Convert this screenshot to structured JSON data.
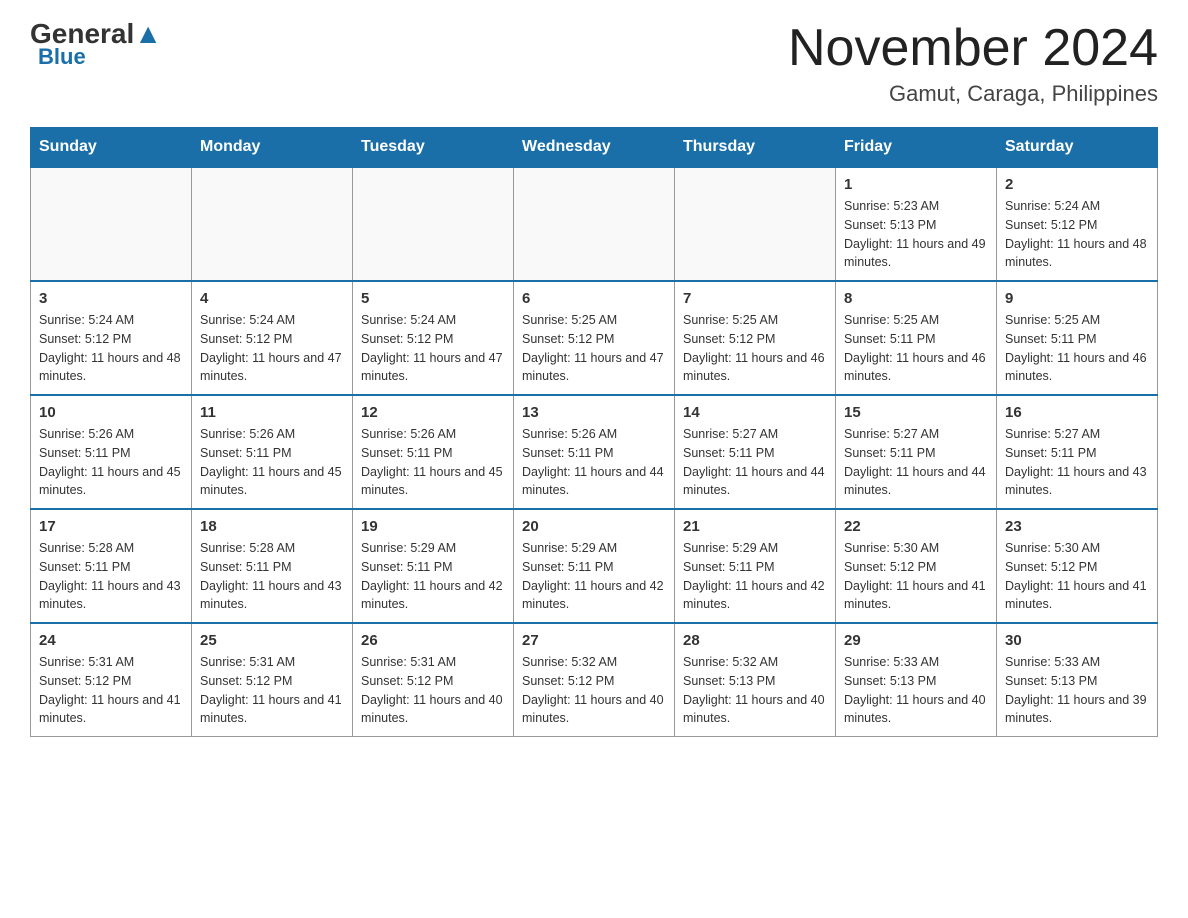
{
  "logo": {
    "general": "General",
    "blue": "Blue"
  },
  "title": "November 2024",
  "subtitle": "Gamut, Caraga, Philippines",
  "days_of_week": [
    "Sunday",
    "Monday",
    "Tuesday",
    "Wednesday",
    "Thursday",
    "Friday",
    "Saturday"
  ],
  "weeks": [
    [
      {
        "day": null,
        "sunrise": null,
        "sunset": null,
        "daylight": null
      },
      {
        "day": null,
        "sunrise": null,
        "sunset": null,
        "daylight": null
      },
      {
        "day": null,
        "sunrise": null,
        "sunset": null,
        "daylight": null
      },
      {
        "day": null,
        "sunrise": null,
        "sunset": null,
        "daylight": null
      },
      {
        "day": null,
        "sunrise": null,
        "sunset": null,
        "daylight": null
      },
      {
        "day": "1",
        "sunrise": "Sunrise: 5:23 AM",
        "sunset": "Sunset: 5:13 PM",
        "daylight": "Daylight: 11 hours and 49 minutes."
      },
      {
        "day": "2",
        "sunrise": "Sunrise: 5:24 AM",
        "sunset": "Sunset: 5:12 PM",
        "daylight": "Daylight: 11 hours and 48 minutes."
      }
    ],
    [
      {
        "day": "3",
        "sunrise": "Sunrise: 5:24 AM",
        "sunset": "Sunset: 5:12 PM",
        "daylight": "Daylight: 11 hours and 48 minutes."
      },
      {
        "day": "4",
        "sunrise": "Sunrise: 5:24 AM",
        "sunset": "Sunset: 5:12 PM",
        "daylight": "Daylight: 11 hours and 47 minutes."
      },
      {
        "day": "5",
        "sunrise": "Sunrise: 5:24 AM",
        "sunset": "Sunset: 5:12 PM",
        "daylight": "Daylight: 11 hours and 47 minutes."
      },
      {
        "day": "6",
        "sunrise": "Sunrise: 5:25 AM",
        "sunset": "Sunset: 5:12 PM",
        "daylight": "Daylight: 11 hours and 47 minutes."
      },
      {
        "day": "7",
        "sunrise": "Sunrise: 5:25 AM",
        "sunset": "Sunset: 5:12 PM",
        "daylight": "Daylight: 11 hours and 46 minutes."
      },
      {
        "day": "8",
        "sunrise": "Sunrise: 5:25 AM",
        "sunset": "Sunset: 5:11 PM",
        "daylight": "Daylight: 11 hours and 46 minutes."
      },
      {
        "day": "9",
        "sunrise": "Sunrise: 5:25 AM",
        "sunset": "Sunset: 5:11 PM",
        "daylight": "Daylight: 11 hours and 46 minutes."
      }
    ],
    [
      {
        "day": "10",
        "sunrise": "Sunrise: 5:26 AM",
        "sunset": "Sunset: 5:11 PM",
        "daylight": "Daylight: 11 hours and 45 minutes."
      },
      {
        "day": "11",
        "sunrise": "Sunrise: 5:26 AM",
        "sunset": "Sunset: 5:11 PM",
        "daylight": "Daylight: 11 hours and 45 minutes."
      },
      {
        "day": "12",
        "sunrise": "Sunrise: 5:26 AM",
        "sunset": "Sunset: 5:11 PM",
        "daylight": "Daylight: 11 hours and 45 minutes."
      },
      {
        "day": "13",
        "sunrise": "Sunrise: 5:26 AM",
        "sunset": "Sunset: 5:11 PM",
        "daylight": "Daylight: 11 hours and 44 minutes."
      },
      {
        "day": "14",
        "sunrise": "Sunrise: 5:27 AM",
        "sunset": "Sunset: 5:11 PM",
        "daylight": "Daylight: 11 hours and 44 minutes."
      },
      {
        "day": "15",
        "sunrise": "Sunrise: 5:27 AM",
        "sunset": "Sunset: 5:11 PM",
        "daylight": "Daylight: 11 hours and 44 minutes."
      },
      {
        "day": "16",
        "sunrise": "Sunrise: 5:27 AM",
        "sunset": "Sunset: 5:11 PM",
        "daylight": "Daylight: 11 hours and 43 minutes."
      }
    ],
    [
      {
        "day": "17",
        "sunrise": "Sunrise: 5:28 AM",
        "sunset": "Sunset: 5:11 PM",
        "daylight": "Daylight: 11 hours and 43 minutes."
      },
      {
        "day": "18",
        "sunrise": "Sunrise: 5:28 AM",
        "sunset": "Sunset: 5:11 PM",
        "daylight": "Daylight: 11 hours and 43 minutes."
      },
      {
        "day": "19",
        "sunrise": "Sunrise: 5:29 AM",
        "sunset": "Sunset: 5:11 PM",
        "daylight": "Daylight: 11 hours and 42 minutes."
      },
      {
        "day": "20",
        "sunrise": "Sunrise: 5:29 AM",
        "sunset": "Sunset: 5:11 PM",
        "daylight": "Daylight: 11 hours and 42 minutes."
      },
      {
        "day": "21",
        "sunrise": "Sunrise: 5:29 AM",
        "sunset": "Sunset: 5:11 PM",
        "daylight": "Daylight: 11 hours and 42 minutes."
      },
      {
        "day": "22",
        "sunrise": "Sunrise: 5:30 AM",
        "sunset": "Sunset: 5:12 PM",
        "daylight": "Daylight: 11 hours and 41 minutes."
      },
      {
        "day": "23",
        "sunrise": "Sunrise: 5:30 AM",
        "sunset": "Sunset: 5:12 PM",
        "daylight": "Daylight: 11 hours and 41 minutes."
      }
    ],
    [
      {
        "day": "24",
        "sunrise": "Sunrise: 5:31 AM",
        "sunset": "Sunset: 5:12 PM",
        "daylight": "Daylight: 11 hours and 41 minutes."
      },
      {
        "day": "25",
        "sunrise": "Sunrise: 5:31 AM",
        "sunset": "Sunset: 5:12 PM",
        "daylight": "Daylight: 11 hours and 41 minutes."
      },
      {
        "day": "26",
        "sunrise": "Sunrise: 5:31 AM",
        "sunset": "Sunset: 5:12 PM",
        "daylight": "Daylight: 11 hours and 40 minutes."
      },
      {
        "day": "27",
        "sunrise": "Sunrise: 5:32 AM",
        "sunset": "Sunset: 5:12 PM",
        "daylight": "Daylight: 11 hours and 40 minutes."
      },
      {
        "day": "28",
        "sunrise": "Sunrise: 5:32 AM",
        "sunset": "Sunset: 5:13 PM",
        "daylight": "Daylight: 11 hours and 40 minutes."
      },
      {
        "day": "29",
        "sunrise": "Sunrise: 5:33 AM",
        "sunset": "Sunset: 5:13 PM",
        "daylight": "Daylight: 11 hours and 40 minutes."
      },
      {
        "day": "30",
        "sunrise": "Sunrise: 5:33 AM",
        "sunset": "Sunset: 5:13 PM",
        "daylight": "Daylight: 11 hours and 39 minutes."
      }
    ]
  ]
}
